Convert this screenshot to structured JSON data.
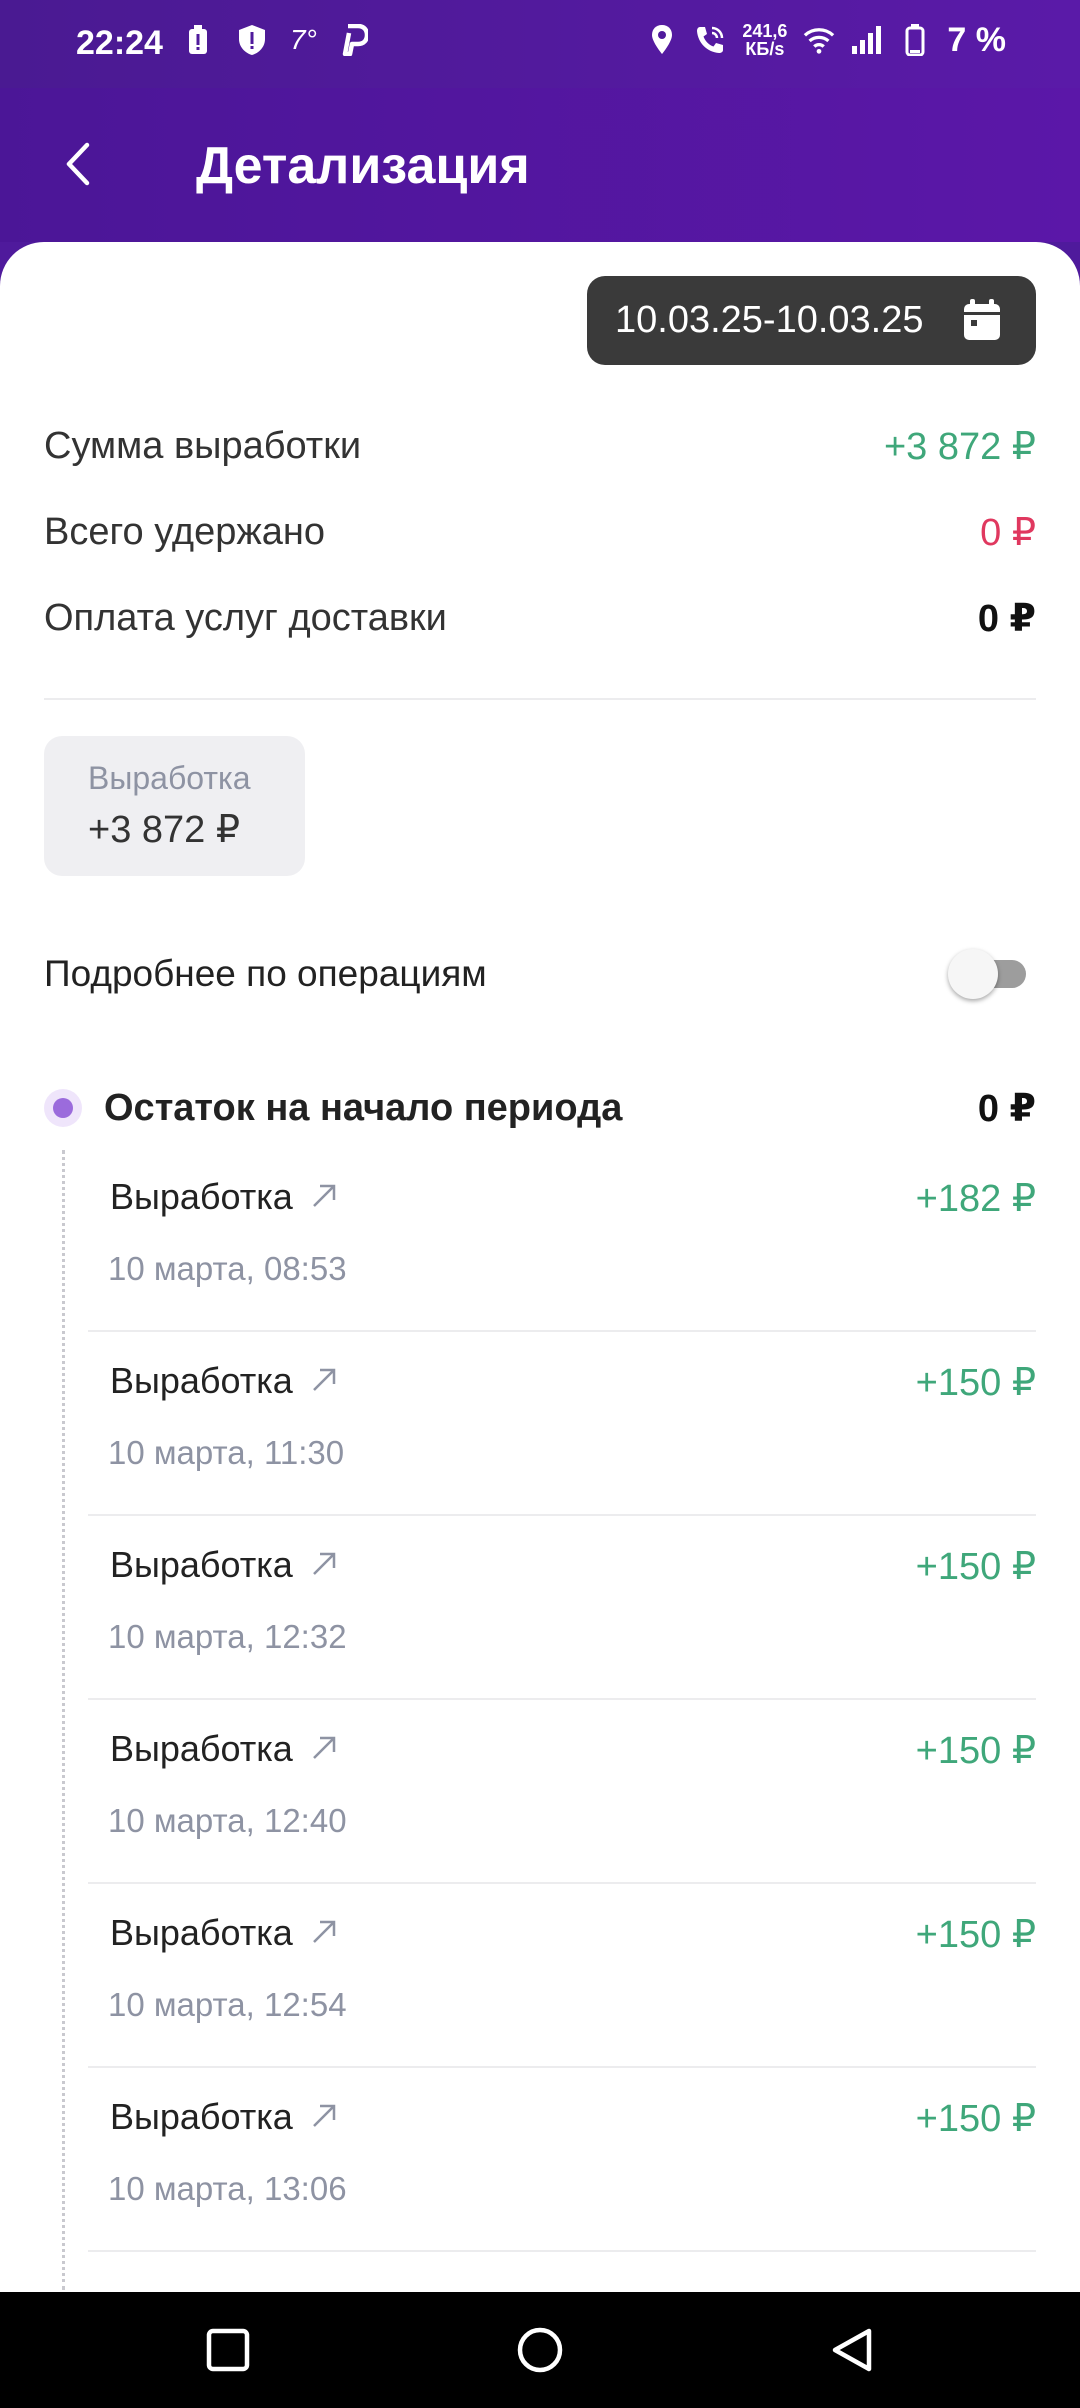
{
  "status_bar": {
    "time": "22:24",
    "temperature": "7°",
    "net_speed_value": "241,6",
    "net_speed_unit": "КБ/s",
    "battery": "7 %",
    "icons": [
      "battery-alert-icon",
      "shield-alert-icon",
      "p-app-icon",
      "location-icon",
      "wifi-call-icon",
      "wifi-icon",
      "signal-icon",
      "battery-icon"
    ]
  },
  "header": {
    "title": "Детализация",
    "back_icon": "back-arrow-icon"
  },
  "date_range": {
    "value": "10.03.25-10.03.25",
    "icon": "calendar-icon"
  },
  "summary": [
    {
      "label": "Сумма выработки",
      "value": "+3 872 ₽",
      "color": "#3fa77a"
    },
    {
      "label": "Всего удержано",
      "value": "0 ₽",
      "color": "#e0385f"
    },
    {
      "label": "Оплата услуг доставки",
      "value": "0 ₽",
      "color": "#111111"
    }
  ],
  "earnings_card": {
    "label": "Выработка",
    "amount": "+3 872 ₽"
  },
  "details_toggle": {
    "label": "Подробнее по операциям",
    "enabled": false
  },
  "opening_balance": {
    "label": "Остаток на начало периода",
    "value": "0 ₽"
  },
  "operations": [
    {
      "title": "Выработка",
      "date": "10 марта, 08:53",
      "amount": "+182 ₽"
    },
    {
      "title": "Выработка",
      "date": "10 марта, 11:30",
      "amount": "+150 ₽"
    },
    {
      "title": "Выработка",
      "date": "10 марта, 12:32",
      "amount": "+150 ₽"
    },
    {
      "title": "Выработка",
      "date": "10 марта, 12:40",
      "amount": "+150 ₽"
    },
    {
      "title": "Выработка",
      "date": "10 марта, 12:54",
      "amount": "+150 ₽"
    },
    {
      "title": "Выработка",
      "date": "10 марта, 13:06",
      "amount": "+150 ₽"
    }
  ],
  "colors": {
    "header_bg": "#5318a2",
    "positive": "#3fa77a",
    "negative": "#e0385f",
    "chip_bg": "#3a3a3a",
    "accent_dot": "#9b6bdc"
  },
  "nav_bar": {
    "icons": [
      "recents-icon",
      "home-icon",
      "back-icon"
    ]
  }
}
